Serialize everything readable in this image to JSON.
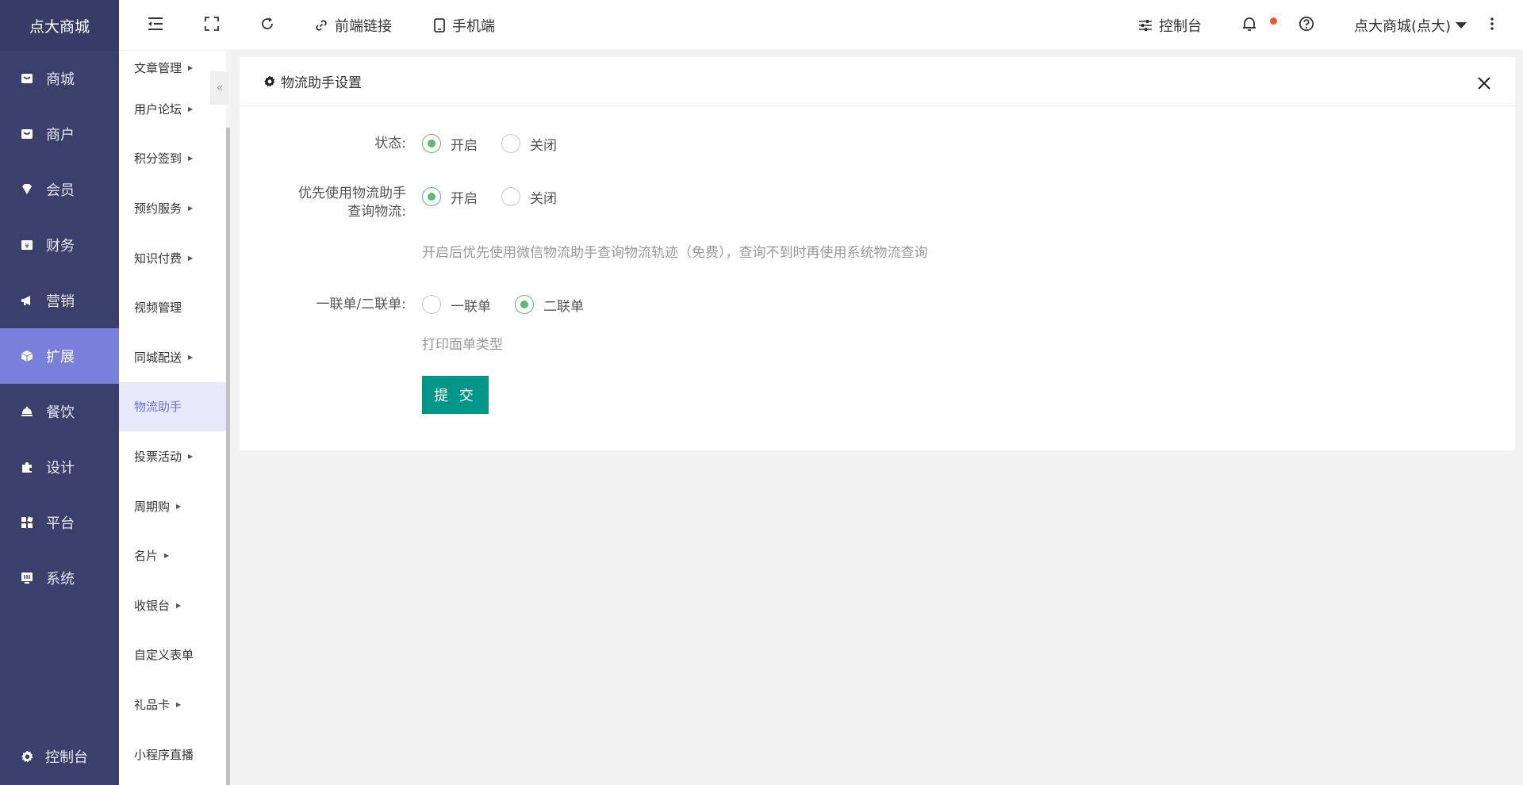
{
  "app": {
    "logo": "点大商城"
  },
  "sidebar": {
    "items": [
      {
        "label": "商城",
        "icon": "shop-icon"
      },
      {
        "label": "商户",
        "icon": "merchant-icon"
      },
      {
        "label": "会员",
        "icon": "member-icon"
      },
      {
        "label": "财务",
        "icon": "finance-icon"
      },
      {
        "label": "营销",
        "icon": "megaphone-icon"
      },
      {
        "label": "扩展",
        "icon": "cube-icon",
        "active": true
      },
      {
        "label": "餐饮",
        "icon": "dining-icon"
      },
      {
        "label": "设计",
        "icon": "puzzle-icon"
      },
      {
        "label": "平台",
        "icon": "grid-icon"
      },
      {
        "label": "系统",
        "icon": "system-icon"
      }
    ],
    "bottom": {
      "label": "控制台",
      "icon": "gear-icon"
    }
  },
  "subnav": {
    "items": [
      {
        "label": "文章管理",
        "has_arrow": true
      },
      {
        "label": "用户论坛",
        "has_arrow": true
      },
      {
        "label": "积分签到",
        "has_arrow": true
      },
      {
        "label": "预约服务",
        "has_arrow": true
      },
      {
        "label": "知识付费",
        "has_arrow": true
      },
      {
        "label": "视频管理",
        "has_arrow": false
      },
      {
        "label": "同城配送",
        "has_arrow": true
      },
      {
        "label": "物流助手",
        "has_arrow": false,
        "active": true
      },
      {
        "label": "投票活动",
        "has_arrow": true
      },
      {
        "label": "周期购",
        "has_arrow": true
      },
      {
        "label": "名片",
        "has_arrow": true
      },
      {
        "label": "收银台",
        "has_arrow": true
      },
      {
        "label": "自定义表单",
        "has_arrow": false
      },
      {
        "label": "礼品卡",
        "has_arrow": true
      },
      {
        "label": "小程序直播",
        "has_arrow": false
      }
    ],
    "collapse_glyph": "«"
  },
  "topbar": {
    "frontend_link": "前端链接",
    "mobile": "手机端",
    "console": "控制台",
    "user": "点大商城(点大)"
  },
  "panel": {
    "title": "物流助手设置",
    "fields": {
      "status": {
        "label": "状态:",
        "options": [
          "开启",
          "关闭"
        ],
        "selected": "开启"
      },
      "priority": {
        "label_line1": "优先使用物流助手",
        "label_line2": "查询物流:",
        "options": [
          "开启",
          "关闭"
        ],
        "selected": "开启",
        "hint": "开启后优先使用微信物流助手查询物流轨迹（免费），查询不到时再使用系统物流查询"
      },
      "sheet": {
        "label": "一联单/二联单:",
        "options": [
          "一联单",
          "二联单"
        ],
        "selected": "二联单",
        "hint": "打印面单类型"
      }
    },
    "submit": "提 交"
  },
  "colors": {
    "sidebar": "#3a3f6b",
    "active_nav": "#7b7fdc",
    "radio_checked": "#5fb878",
    "submit": "#009688",
    "notify_dot": "#f2572d"
  }
}
